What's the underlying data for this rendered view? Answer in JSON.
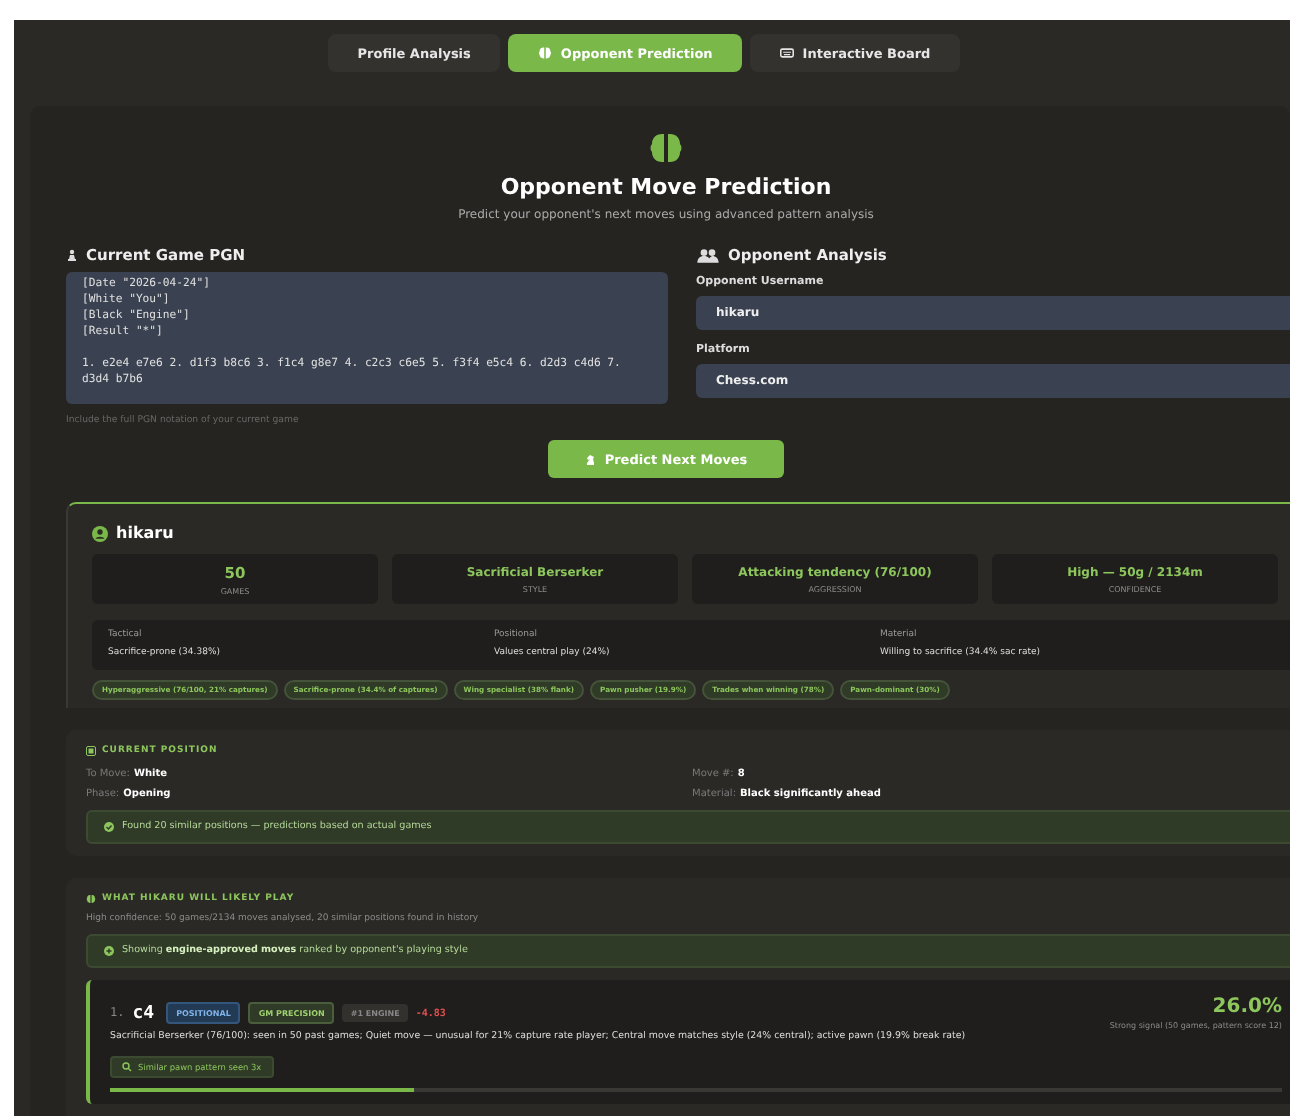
{
  "tabs": [
    {
      "label": "Profile Analysis",
      "selected": false
    },
    {
      "label": "Opponent Prediction",
      "selected": true
    },
    {
      "label": "Interactive Board",
      "selected": false
    }
  ],
  "header": {
    "title": "Opponent Move Prediction",
    "subtitle": "Predict your opponent's next moves using advanced pattern analysis"
  },
  "pgn": {
    "label": "Current Game PGN",
    "value": "[Date \"2026-04-24\"]\n[White \"You\"]\n[Black \"Engine\"]\n[Result \"*\"]\n\n1. e2e4 e7e6 2. d1f3 b8c6 3. f1c4 g8e7 4. c2c3 c6e5 5. f3f4 e5c4 6. d2d3 c4d6 7. d3d4 b7b6",
    "hint": "Include the full PGN notation of your current game"
  },
  "opponent": {
    "label": "Opponent Analysis",
    "username_label": "Opponent Username",
    "username": "hikaru",
    "platform_label": "Platform",
    "platform": "Chess.com"
  },
  "predict_button": "Predict Next Moves",
  "profile": {
    "name": "hikaru",
    "stats": [
      {
        "value": "50",
        "label": "GAMES"
      },
      {
        "value": "Sacrificial Berserker",
        "label": "STYLE"
      },
      {
        "value": "Attacking tendency (76/100)",
        "label": "AGGRESSION"
      },
      {
        "value": "High — 50g / 2134m",
        "label": "CONFIDENCE"
      }
    ],
    "traits": [
      {
        "label": "Tactical",
        "value": "Sacrifice-prone (34.38%)"
      },
      {
        "label": "Positional",
        "value": "Values central play (24%)"
      },
      {
        "label": "Material",
        "value": "Willing to sacrifice (34.4% sac rate)"
      }
    ],
    "tags": [
      "Hyperaggressive (76/100, 21% captures)",
      "Sacrifice-prone (34.4% of captures)",
      "Wing specialist (38% flank)",
      "Pawn pusher (19.9%)",
      "Trades when winning (78%)",
      "Pawn-dominant (30%)"
    ]
  },
  "position": {
    "heading": "CURRENT POSITION",
    "fields": [
      {
        "label": "To Move:",
        "value": "White"
      },
      {
        "label": "Move #:",
        "value": "8"
      },
      {
        "label": "Phase:",
        "value": "Opening"
      },
      {
        "label": "Material:",
        "value": "Black significantly ahead"
      }
    ],
    "note": "Found 20 similar positions — predictions based on actual games"
  },
  "likely": {
    "heading": "WHAT HIKARU WILL LIKELY PLAY",
    "summary": "High confidence: 50 games/2134 moves analysed, 20 similar positions found in history",
    "note": "Showing **engine-approved moves** ranked by opponent's playing style",
    "moves": [
      {
        "rank": "1.",
        "move": "c4",
        "badges": [
          {
            "text": "POSITIONAL",
            "kind": "blue"
          },
          {
            "text": "GM PRECISION",
            "kind": "green"
          },
          {
            "text": "#1 ENGINE",
            "kind": "grey"
          }
        ],
        "eval": "-4.83",
        "percent": "26.0%",
        "signal": "Strong signal (50 games, pattern score 12)",
        "description": "Sacrificial Berserker (76/100): seen in 50 past games; Quiet move — unusual for 21% capture rate player; Central move matches style (24% central); active pawn (19.9% break rate)",
        "pattern": "Similar pawn pattern seen 3x",
        "level": 0.26
      }
    ]
  }
}
